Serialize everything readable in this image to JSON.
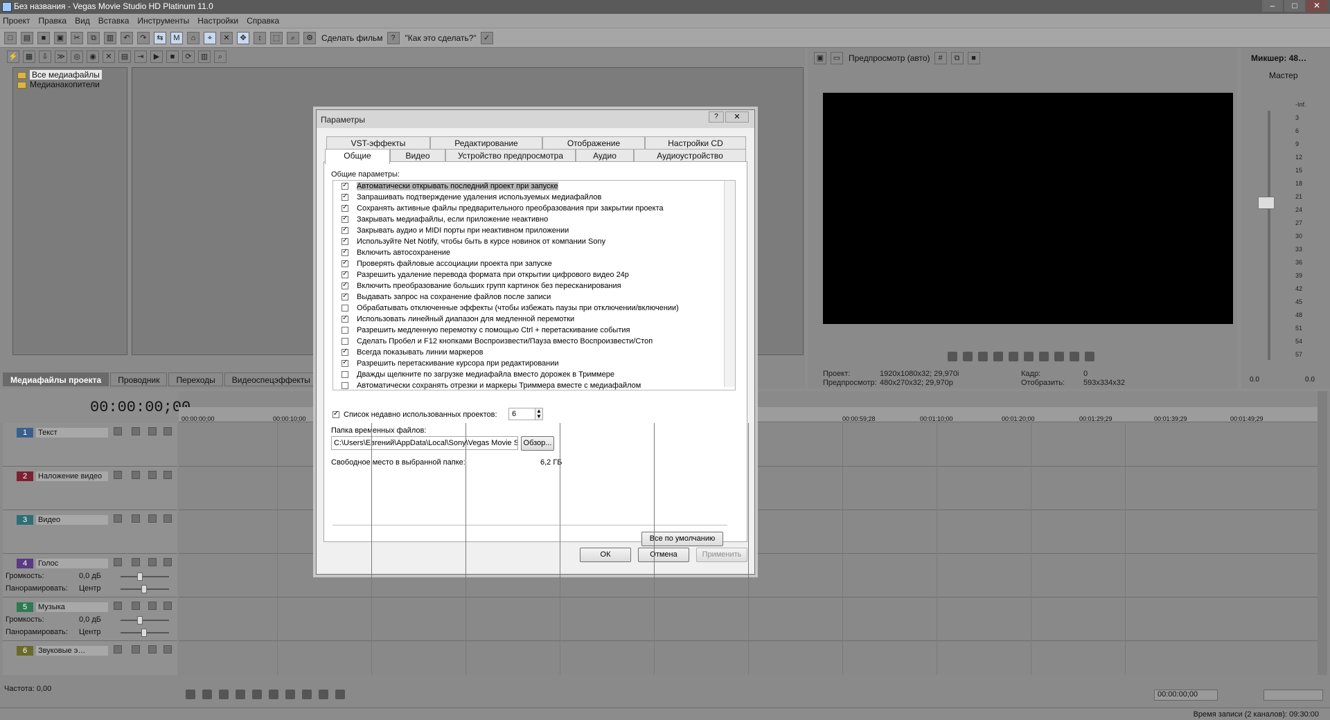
{
  "window": {
    "title": "Без названия - Vegas Movie Studio HD Platinum 11.0",
    "controls": [
      "–",
      "□",
      "✕"
    ]
  },
  "menu": [
    "Проект",
    "Правка",
    "Вид",
    "Вставка",
    "Инструменты",
    "Настройки",
    "Справка"
  ],
  "toolbar": {
    "make_movie": "Сделать фильм",
    "how_to": "\"Как это сделать?\""
  },
  "explorer": {
    "tree": [
      "Все медиафайлы",
      "Медианакопители"
    ],
    "window_tabs": [
      "Медиафайлы проекта",
      "Проводник",
      "Переходы",
      "Видеоспецэффекты"
    ]
  },
  "preview": {
    "mode": "Предпросмотр (авто)",
    "info": {
      "project_label": "Проект:",
      "project_value": "1920x1080x32; 29,970i",
      "preview_label": "Предпросмотр:",
      "preview_value": "480x270x32; 29,970p",
      "frame_label": "Кадр:",
      "frame_value": "0",
      "display_label": "Отобразить:",
      "display_value": "593x334x32"
    }
  },
  "mixer": {
    "title": "Микшер: 48…",
    "master": "Мастер",
    "ticks": [
      "-Inf.",
      "3",
      "6",
      "9",
      "12",
      "15",
      "18",
      "21",
      "24",
      "27",
      "30",
      "33",
      "36",
      "39",
      "42",
      "45",
      "48",
      "51",
      "54",
      "57"
    ],
    "readout_left": "0.0",
    "readout_right": "0.0"
  },
  "timeline": {
    "timecode": "00:00:00;00",
    "ruler": [
      "00:00:00;00",
      "00:00:10;00",
      "00:00:59;28",
      "00:01:10;00",
      "00:01:20;00",
      "00:01:29;29",
      "00:01:39;29",
      "00:01:49;29"
    ],
    "tracks": [
      {
        "num": "1",
        "name": "Текст",
        "color": "#3b5f8c",
        "type": "video"
      },
      {
        "num": "2",
        "name": "Наложение видео",
        "color": "#7b2232",
        "type": "video"
      },
      {
        "num": "3",
        "name": "Видео",
        "color": "#2d6f77",
        "type": "video"
      },
      {
        "num": "4",
        "name": "Голос",
        "color": "#5a3a82",
        "type": "audio",
        "vol_label": "Громкость:",
        "vol": "0,0 дБ",
        "pan_label": "Панорамировать:",
        "pan": "Центр"
      },
      {
        "num": "5",
        "name": "Музыка",
        "color": "#2f7a52",
        "type": "audio",
        "vol_label": "Громкость:",
        "vol": "0,0 дБ",
        "pan_label": "Панорамировать:",
        "pan": "Центр"
      },
      {
        "num": "6",
        "name": "Звуковые э…",
        "color": "#6c6a2a",
        "type": "audio"
      }
    ],
    "rate": "Частота: 0,00",
    "tc_end": "00:00:00;00",
    "record_time": "Время записи (2 каналов): 09:30:00"
  },
  "dialog": {
    "title": "Параметры",
    "tabs_row1": [
      "VST-эффекты",
      "Редактирование",
      "Отображение",
      "Настройки CD"
    ],
    "tabs_row2": [
      "Общие",
      "Видео",
      "Устройство предпросмотра",
      "Аудио",
      "Аудиоустройство"
    ],
    "group_label": "Общие параметры:",
    "options": [
      {
        "text": "Автоматически открывать последний проект при запуске",
        "checked": true
      },
      {
        "text": "Запрашивать подтверждение удаления используемых медиафайлов",
        "checked": true
      },
      {
        "text": "Сохранять активные файлы предварительного преобразования при закрытии проекта",
        "checked": true
      },
      {
        "text": "Закрывать медиафайлы, если приложение неактивно",
        "checked": true
      },
      {
        "text": "Закрывать аудио и MIDI порты при неактивном приложении",
        "checked": true
      },
      {
        "text": "Используйте Net Notify, чтобы быть в курсе новинок от компании Sony",
        "checked": true
      },
      {
        "text": "Включить автосохранение",
        "checked": true
      },
      {
        "text": "Проверять файловые ассоциации проекта при запуске",
        "checked": true
      },
      {
        "text": "Разрешить удаление перевода формата при открытии цифрового видео 24p",
        "checked": true
      },
      {
        "text": "Включить преобразование больших групп картинок без пересканирования",
        "checked": true
      },
      {
        "text": "Выдавать запрос на сохранение файлов после записи",
        "checked": true
      },
      {
        "text": "Обрабатывать отключенные эффекты (чтобы избежать паузы при отключении/включении)",
        "checked": false
      },
      {
        "text": "Использовать линейный диапазон для медленной перемотки",
        "checked": true
      },
      {
        "text": "Разрешить медленную перемотку с помощью Ctrl + перетаскивание события",
        "checked": false
      },
      {
        "text": "Сделать Пробел и F12 кнопками Воспроизвести/Пауза вместо Воспроизвести/Стоп",
        "checked": false
      },
      {
        "text": "Всегда показывать линии маркеров",
        "checked": true
      },
      {
        "text": "Разрешить перетаскивание курсора при редактировании",
        "checked": true
      },
      {
        "text": "Дважды щелкните по загрузке медиафайла вместо дорожек в Триммере",
        "checked": false
      },
      {
        "text": "Автоматически сохранять отрезки и маркеры Триммера вместе с медиафайлом",
        "checked": false
      }
    ],
    "recent_label": "Список недавно использованных проектов:",
    "recent_value": "6",
    "temp_label": "Папка временных файлов:",
    "temp_path": "C:\\Users\\Евгений\\AppData\\Local\\Sony\\Vegas Movie Studio HD P",
    "browse": "Обзор...",
    "free_label": "Свободное место в выбранной папке:",
    "free_value": "6,2 ГБ",
    "defaults": "Все по умолчанию",
    "ok": "ОК",
    "cancel": "Отмена",
    "apply": "Применить"
  }
}
